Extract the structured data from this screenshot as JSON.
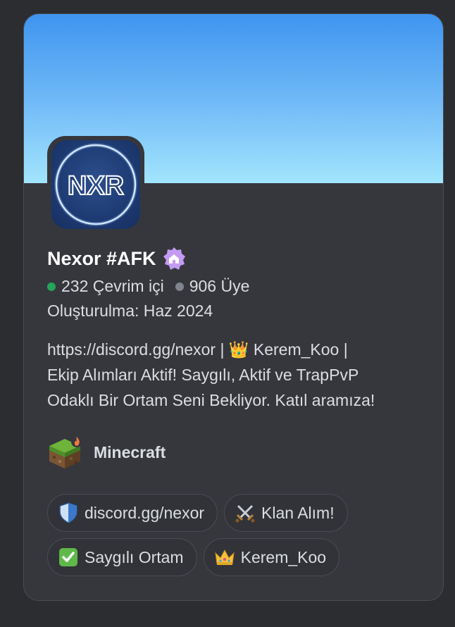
{
  "server": {
    "name": "Nexor #AFK",
    "avatar_text": "NXR",
    "online": "232 Çevrim içi",
    "members": "906 Üye",
    "created": "Oluşturulma: Haz 2024",
    "description_lines": [
      "https://discord.gg/nexor | 👑 Kerem_Koo |",
      "Ekip Alımları Aktif! Saygılı, Aktif ve TrapPvP",
      "Odaklı Bir Ortam Seni Bekliyor. Katıl aramıza!"
    ],
    "game": "Minecraft"
  },
  "tags": [
    {
      "icon": "shield-icon",
      "label": "discord.gg/nexor"
    },
    {
      "icon": "crossed-swords-icon",
      "label": "Klan Alım!"
    },
    {
      "icon": "check-mark-icon",
      "label": "Saygılı Ortam"
    },
    {
      "icon": "crown-icon",
      "label": "Kerem_Koo"
    }
  ],
  "colors": {
    "banner_top": "#3e95ef",
    "banner_bottom": "#a2e5fd",
    "online": "#23a55a",
    "members": "#80848e",
    "card": "#36373d"
  }
}
